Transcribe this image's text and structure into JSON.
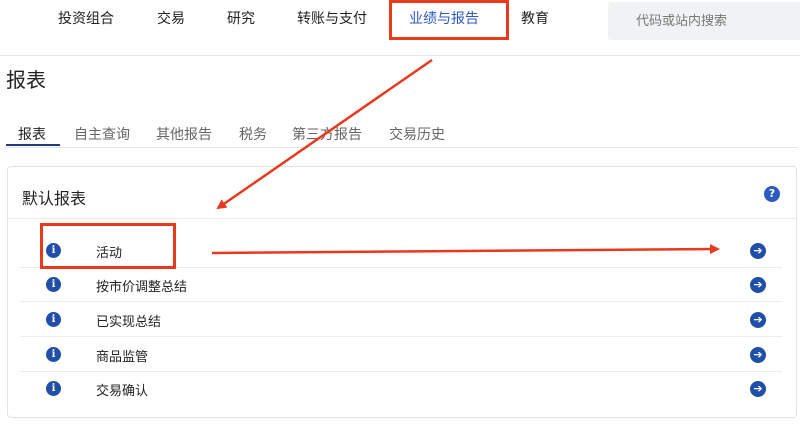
{
  "nav": {
    "items": [
      "投资组合",
      "交易",
      "研究",
      "转账与支付",
      "业绩与报告",
      "教育"
    ],
    "active_index": 4,
    "search_placeholder": "代码或站内搜索"
  },
  "page": {
    "title": "报表"
  },
  "subtabs": {
    "items": [
      "报表",
      "自主查询",
      "其他报告",
      "税务",
      "第三方报告",
      "交易历史"
    ],
    "active_index": 0
  },
  "card": {
    "title": "默认报表",
    "help_icon": "?",
    "rows": [
      {
        "label": "活动"
      },
      {
        "label": "按市价调整总结"
      },
      {
        "label": "已实现总结"
      },
      {
        "label": "商品监管"
      },
      {
        "label": "交易确认"
      }
    ]
  },
  "icons": {
    "info": "i",
    "arrow": "➔"
  },
  "colors": {
    "accent": "#2c5ac2",
    "annotation": "#e8391f",
    "icon_blue": "#1f4fa8"
  }
}
